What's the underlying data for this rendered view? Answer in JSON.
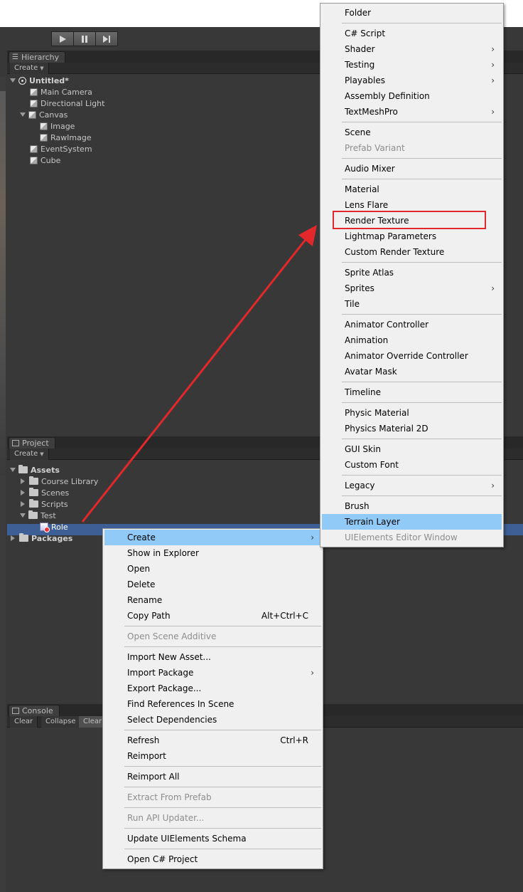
{
  "toolbar": {
    "play_icon": "play-icon",
    "pause_icon": "pause-icon",
    "step_icon": "step-icon"
  },
  "hierarchy": {
    "tab": "Hierarchy",
    "create": "Create",
    "items": [
      {
        "label": "Untitled*",
        "icon": "unity-scene-icon",
        "bold": true
      },
      {
        "label": "Main Camera",
        "icon": "gameobject-icon"
      },
      {
        "label": "Directional Light",
        "icon": "gameobject-icon"
      },
      {
        "label": "Canvas",
        "icon": "gameobject-icon"
      },
      {
        "label": "Image",
        "icon": "gameobject-icon"
      },
      {
        "label": "RawImage",
        "icon": "gameobject-icon"
      },
      {
        "label": "EventSystem",
        "icon": "gameobject-icon"
      },
      {
        "label": "Cube",
        "icon": "gameobject-icon"
      }
    ]
  },
  "project": {
    "tab": "Project",
    "create": "Create",
    "items": [
      {
        "label": "Assets",
        "bold": true
      },
      {
        "label": "Course Library"
      },
      {
        "label": "Scenes"
      },
      {
        "label": "Scripts"
      },
      {
        "label": "Test"
      },
      {
        "label": "Role",
        "selected": true
      },
      {
        "label": "Packages",
        "bold": true
      }
    ]
  },
  "console": {
    "tab": "Console",
    "buttons": [
      "Clear",
      "Collapse",
      "Clear"
    ]
  },
  "context_menu": {
    "items": [
      {
        "label": "Create",
        "submenu": true,
        "highlight": true
      },
      {
        "label": "Show in Explorer"
      },
      {
        "label": "Open"
      },
      {
        "label": "Delete"
      },
      {
        "label": "Rename"
      },
      {
        "label": "Copy Path",
        "shortcut": "Alt+Ctrl+C"
      },
      {
        "label": "Open Scene Additive",
        "disabled": true
      },
      {
        "label": "Import New Asset..."
      },
      {
        "label": "Import Package",
        "submenu": true
      },
      {
        "label": "Export Package..."
      },
      {
        "label": "Find References In Scene"
      },
      {
        "label": "Select Dependencies"
      },
      {
        "label": "Refresh",
        "shortcut": "Ctrl+R"
      },
      {
        "label": "Reimport"
      },
      {
        "label": "Reimport All"
      },
      {
        "label": "Extract From Prefab",
        "disabled": true
      },
      {
        "label": "Run API Updater...",
        "disabled": true
      },
      {
        "label": "Update UIElements Schema"
      },
      {
        "label": "Open C# Project"
      }
    ]
  },
  "create_submenu": {
    "items": [
      {
        "label": "Folder"
      },
      {
        "label": "C# Script"
      },
      {
        "label": "Shader",
        "submenu": true
      },
      {
        "label": "Testing",
        "submenu": true
      },
      {
        "label": "Playables",
        "submenu": true
      },
      {
        "label": "Assembly Definition"
      },
      {
        "label": "TextMeshPro",
        "submenu": true
      },
      {
        "label": "Scene"
      },
      {
        "label": "Prefab Variant",
        "disabled": true
      },
      {
        "label": "Audio Mixer"
      },
      {
        "label": "Material"
      },
      {
        "label": "Lens Flare"
      },
      {
        "label": "Render Texture",
        "annotated": true
      },
      {
        "label": "Lightmap Parameters"
      },
      {
        "label": "Custom Render Texture"
      },
      {
        "label": "Sprite Atlas"
      },
      {
        "label": "Sprites",
        "submenu": true
      },
      {
        "label": "Tile"
      },
      {
        "label": "Animator Controller"
      },
      {
        "label": "Animation"
      },
      {
        "label": "Animator Override Controller"
      },
      {
        "label": "Avatar Mask"
      },
      {
        "label": "Timeline"
      },
      {
        "label": "Physic Material"
      },
      {
        "label": "Physics Material 2D"
      },
      {
        "label": "GUI Skin"
      },
      {
        "label": "Custom Font"
      },
      {
        "label": "Legacy",
        "submenu": true
      },
      {
        "label": "Brush"
      },
      {
        "label": "Terrain Layer",
        "highlight": true
      },
      {
        "label": "UIElements Editor Window",
        "disabled": true
      }
    ]
  },
  "colors": {
    "annotation": "#e3282b",
    "menu_highlight": "#91c9f7",
    "selection": "#3e5f96"
  }
}
